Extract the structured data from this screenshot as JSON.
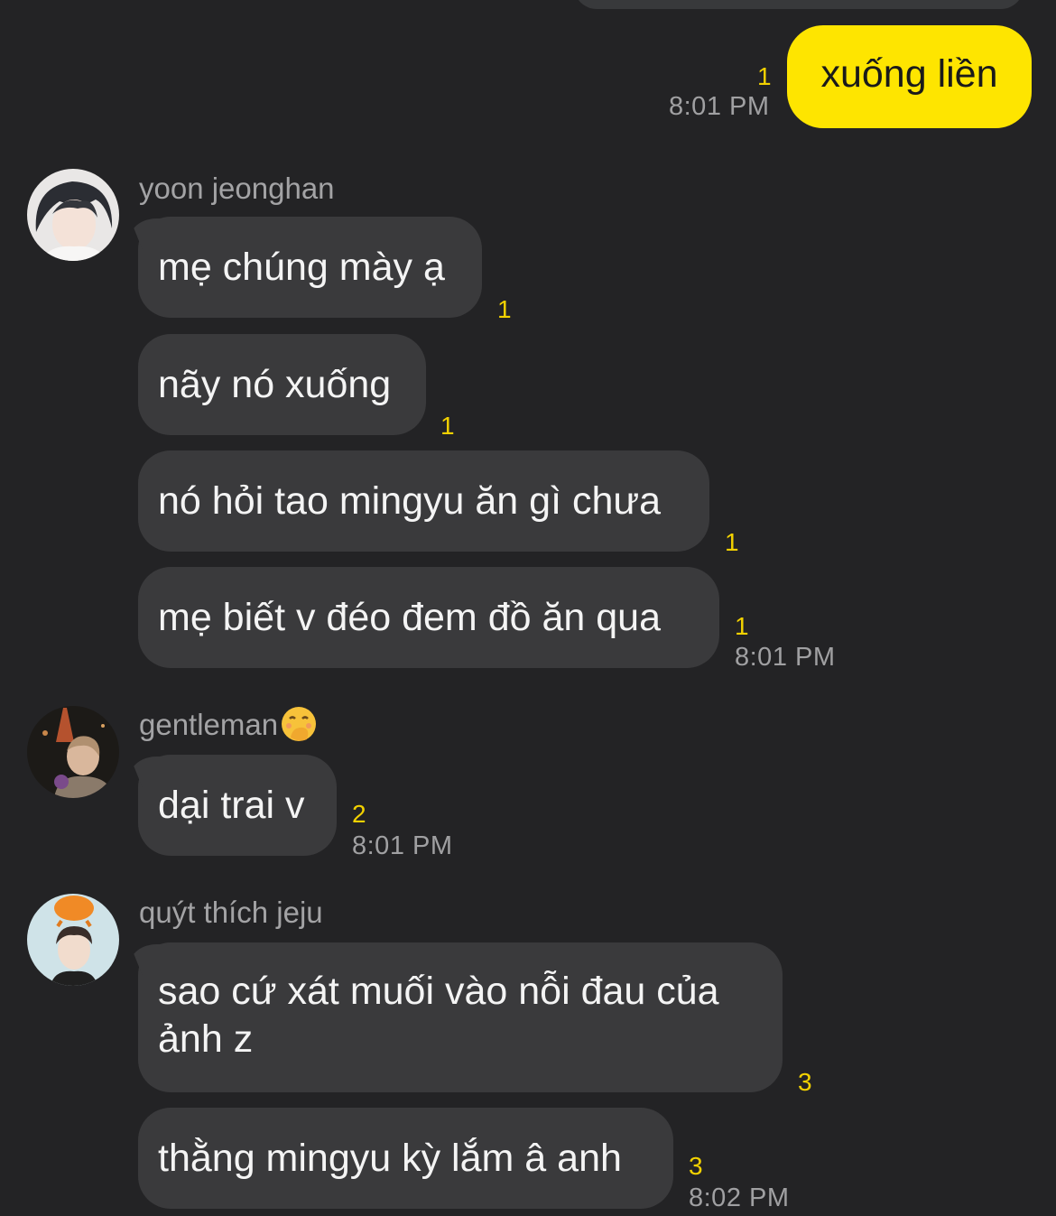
{
  "outgoing": {
    "text": "xuống liền",
    "unread": "1",
    "time": "8:01 PM",
    "color": "#fee500"
  },
  "groups": [
    {
      "sender": "yoon jeonghan",
      "messages": [
        {
          "text": "mẹ chúng mày ạ",
          "unread": "1"
        },
        {
          "text": "nãy nó xuống",
          "unread": "1"
        },
        {
          "text": "nó hỏi tao mingyu ăn gì chưa",
          "unread": "1"
        },
        {
          "text": "mẹ biết v đéo đem đồ ăn qua",
          "unread": "1",
          "time": "8:01 PM"
        }
      ]
    },
    {
      "sender": "gentleman",
      "sender_emoji": "hand-over-mouth-emoji",
      "messages": [
        {
          "text": "dại trai v",
          "unread": "2",
          "time": "8:01 PM"
        }
      ]
    },
    {
      "sender": "quýt thích jeju",
      "messages": [
        {
          "text": "sao cứ xát muối vào nỗi đau của ảnh z",
          "unread": "3"
        },
        {
          "text": "thằng mingyu kỳ lắm â anh",
          "unread": "3",
          "time": "8:02 PM"
        }
      ]
    }
  ],
  "theme": {
    "background": "#232325",
    "incoming_bubble": "#3a3a3c",
    "unread_color": "#f2d100"
  }
}
